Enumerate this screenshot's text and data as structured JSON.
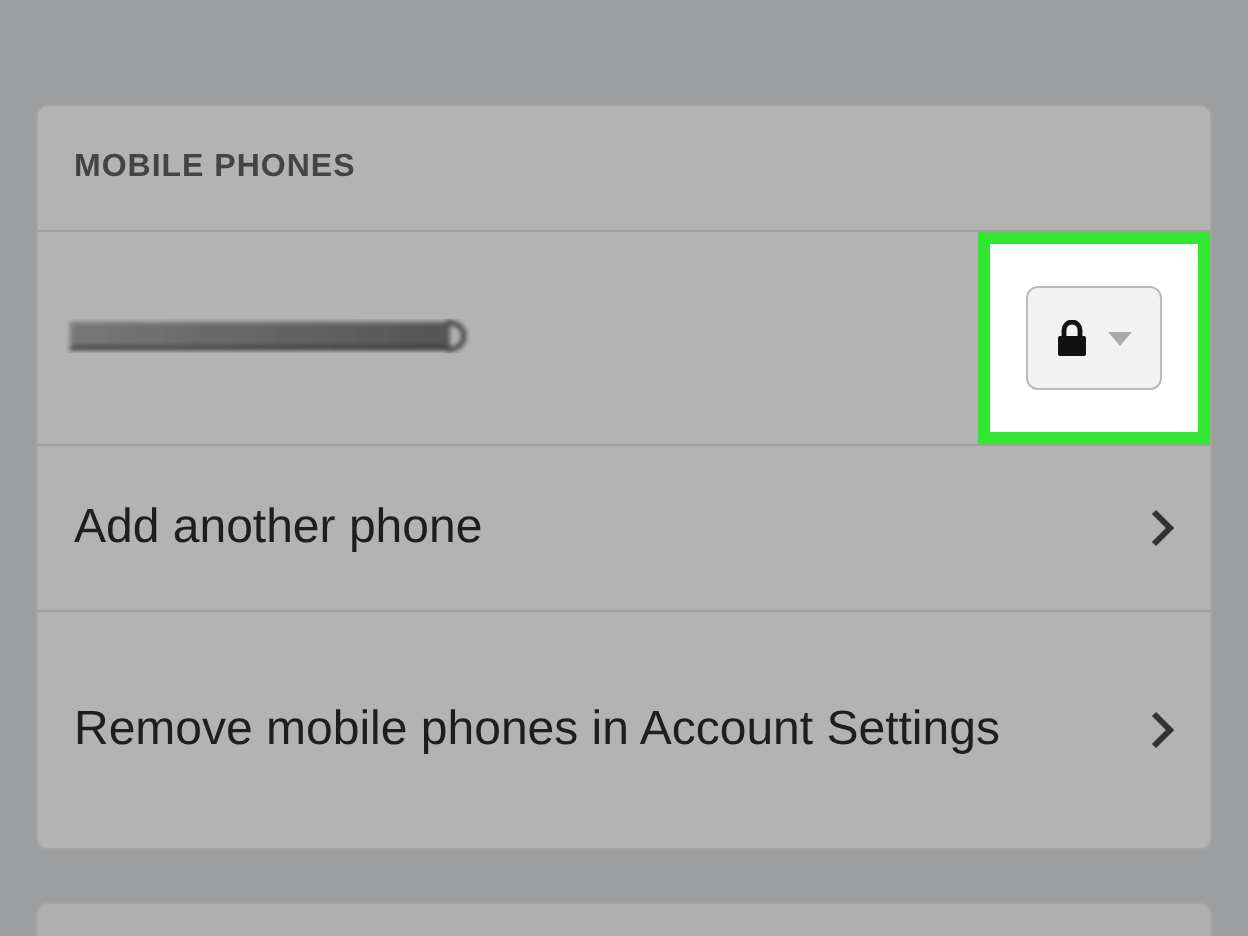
{
  "section": {
    "title": "MOBILE PHONES",
    "phone": {
      "kind": "redacted",
      "privacy_button": {
        "highlighted": true
      }
    },
    "rows": [
      {
        "label": "Add another phone"
      },
      {
        "label": "Remove mobile phones in Account Settings"
      }
    ]
  }
}
